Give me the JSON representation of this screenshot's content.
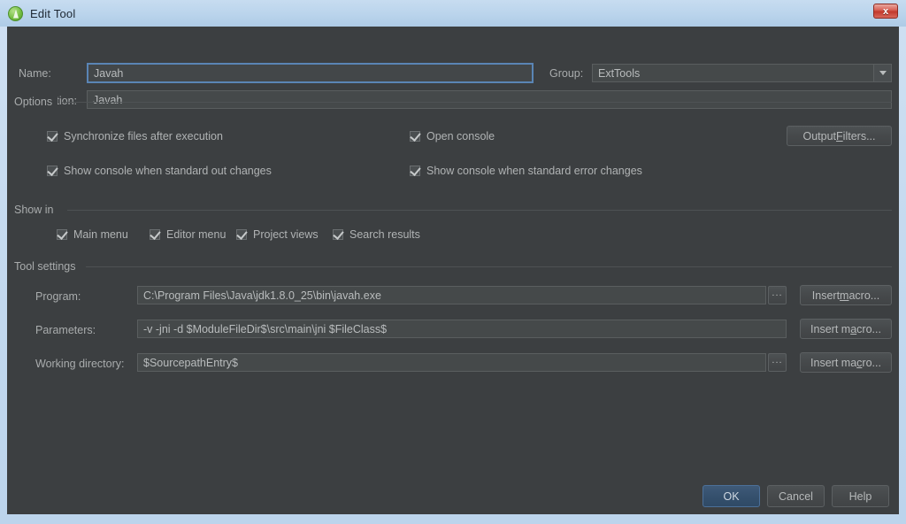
{
  "window": {
    "title": "Edit Tool",
    "icon": "android-tool-icon",
    "close_label": "x",
    "frame_color": "#bad4ec",
    "dialog_bg": "#3c3f41"
  },
  "form": {
    "name_label": "Name:",
    "name_value": "Javah",
    "group_label": "Group:",
    "group_value": "ExtTools",
    "description_label": "Description:",
    "description_value": "Javah"
  },
  "options": {
    "section_title": "Options",
    "checkboxes": [
      {
        "label": "Synchronize files after execution",
        "checked": true
      },
      {
        "label": "Show console when standard out changes",
        "checked": true
      },
      {
        "label": "Open console",
        "checked": true
      },
      {
        "label": "Show console when standard error changes",
        "checked": true
      }
    ],
    "output_filters": {
      "prefix": "Output ",
      "mnemonic": "F",
      "suffix": "ilters..."
    }
  },
  "show_in": {
    "section_title": "Show in",
    "checkboxes": [
      {
        "label": "Main menu",
        "checked": true
      },
      {
        "label": "Editor menu",
        "checked": true
      },
      {
        "label": "Project views",
        "checked": true
      },
      {
        "label": "Search results",
        "checked": true
      }
    ]
  },
  "tool_settings": {
    "section_title": "Tool settings",
    "rows": [
      {
        "label": "Program:",
        "value": "C:\\Program Files\\Java\\jdk1.8.0_25\\bin\\javah.exe",
        "browse_label": "...",
        "has_browse": true,
        "macro": {
          "prefix": "Insert ",
          "mnemonic": "m",
          "suffix": "acro..."
        }
      },
      {
        "label": "Parameters:",
        "value": "-v -jni -d $ModuleFileDir$\\src\\main\\jni $FileClass$",
        "browse_label": "",
        "has_browse": false,
        "macro": {
          "prefix": "Insert m",
          "mnemonic": "a",
          "suffix": "cro..."
        }
      },
      {
        "label": "Working directory:",
        "value": "$SourcepathEntry$",
        "browse_label": "...",
        "has_browse": true,
        "macro": {
          "prefix": "Insert ma",
          "mnemonic": "c",
          "suffix": "ro..."
        }
      }
    ]
  },
  "footer": {
    "ok_label": "OK",
    "cancel_label": "Cancel",
    "help_label": "Help"
  }
}
